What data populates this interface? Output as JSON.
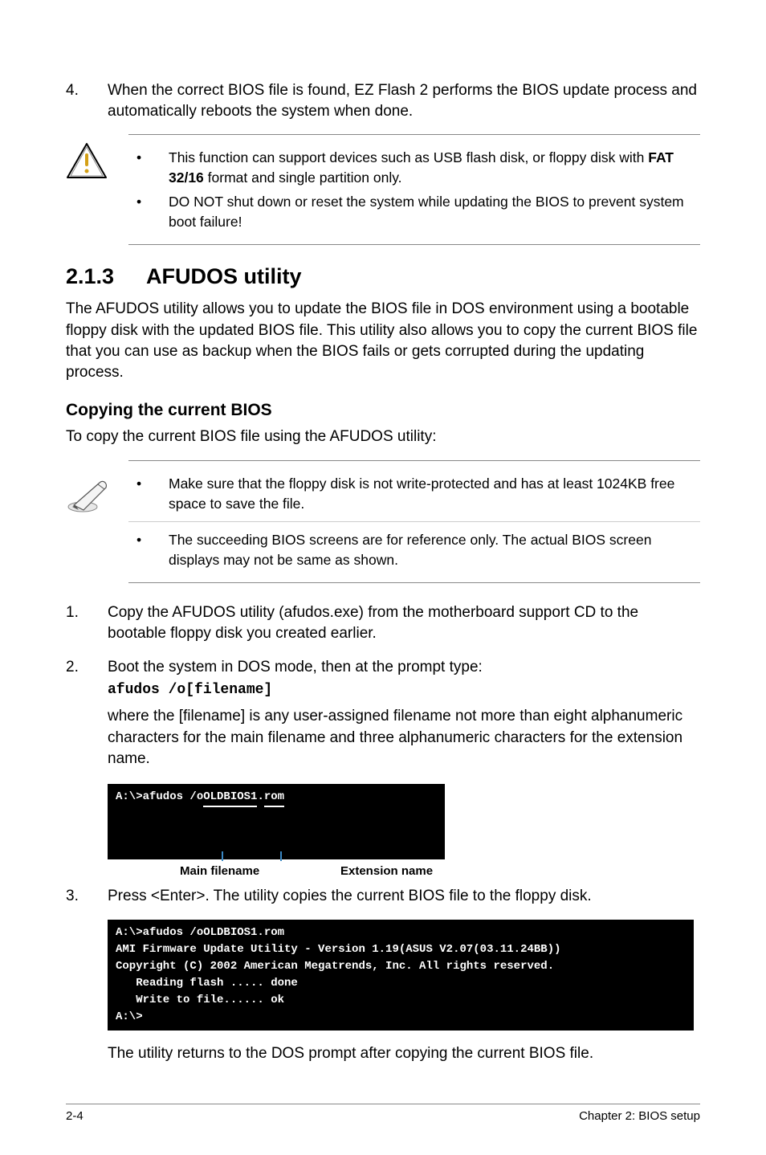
{
  "step4": {
    "num": "4.",
    "text": "When the correct BIOS file is found, EZ Flash 2 performs the BIOS update process and automatically reboots the system when done."
  },
  "caution": {
    "items": [
      {
        "pre": "This function can support devices such as USB flash disk, or floppy disk with ",
        "bold": "FAT 32/16",
        "post": " format and single partition only."
      },
      {
        "pre": "DO NOT shut down or reset the system while updating the BIOS to prevent system boot failure!",
        "bold": "",
        "post": ""
      }
    ]
  },
  "section": {
    "num": "2.1.3",
    "title": "AFUDOS utility",
    "intro": "The AFUDOS utility allows you to update the BIOS file in DOS environment using a bootable floppy disk with the updated BIOS file. This utility also allows you to copy the current BIOS file that you can use as backup when the BIOS fails or gets corrupted during the updating process."
  },
  "sub": {
    "title": "Copying the current BIOS",
    "intro": "To copy the current BIOS file using the AFUDOS utility:"
  },
  "note": {
    "items": [
      "Make sure that the floppy disk is not write-protected and has at least 1024KB free space to save the file.",
      "The succeeding BIOS screens are for reference only. The actual BIOS screen displays may not be same as shown."
    ]
  },
  "steps": {
    "s1": {
      "num": "1.",
      "text": "Copy the AFUDOS utility (afudos.exe) from the motherboard support CD to the bootable floppy disk you created earlier."
    },
    "s2": {
      "num": "2.",
      "text": "Boot the system in DOS mode, then at the prompt type:"
    },
    "cmd": "afudos /o[filename]",
    "explain": "where the [filename] is any user-assigned filename not more than eight alphanumeric characters  for the main filename and three alphanumeric characters for the extension name.",
    "term1_prefix": "A:\\>afudos /o",
    "term1_main": "OLDBIOS1",
    "term1_dot": ".",
    "term1_ext": "rom",
    "label_main": "Main filename",
    "label_ext": "Extension name",
    "s3": {
      "num": "3.",
      "text": "Press <Enter>. The utility copies the current BIOS file to the floppy disk."
    },
    "term2_lines": [
      "A:\\>afudos /oOLDBIOS1.rom",
      "AMI Firmware Update Utility - Version 1.19(ASUS V2.07(03.11.24BB))",
      "Copyright (C) 2002 American Megatrends, Inc. All rights reserved.",
      "   Reading flash ..... done",
      "   Write to file...... ok",
      "A:\\>"
    ],
    "after": "The utility returns to the DOS prompt after copying the current BIOS file."
  },
  "footer": {
    "left": "2-4",
    "right": "Chapter 2: BIOS setup"
  }
}
